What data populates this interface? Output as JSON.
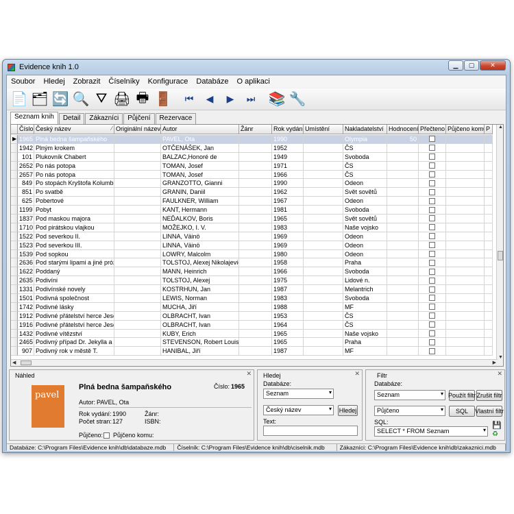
{
  "window": {
    "title": "Evidence knih 1.0"
  },
  "menu": [
    "Soubor",
    "Hledej",
    "Zobrazit",
    "Číselníky",
    "Konfigurace",
    "Databáze",
    "O aplikaci"
  ],
  "toolbar": [
    {
      "name": "new-document-icon",
      "glyph": "📄"
    },
    {
      "name": "form-view-icon",
      "glyph": "🗂"
    },
    {
      "name": "refresh-icon",
      "glyph": "🔄"
    },
    {
      "name": "search-icon",
      "glyph": "🔍"
    },
    {
      "name": "filter-icon",
      "glyph": "⛛"
    },
    {
      "name": "print-icon",
      "glyph": "🖨"
    },
    {
      "name": "print-preview-icon",
      "glyph": "🖶"
    },
    {
      "name": "exit-icon",
      "glyph": "🚪"
    },
    {
      "name": "first-record-icon",
      "glyph": "⏮"
    },
    {
      "name": "previous-record-icon",
      "glyph": "◀"
    },
    {
      "name": "next-record-icon",
      "glyph": "▶"
    },
    {
      "name": "last-record-icon",
      "glyph": "⏭"
    },
    {
      "name": "books-icon",
      "glyph": "📚"
    },
    {
      "name": "tools-icon",
      "glyph": "🔧"
    }
  ],
  "tabs": [
    "Seznam knih",
    "Detail",
    "Zákazníci",
    "Půjčení",
    "Rezervace"
  ],
  "grid": {
    "columns": [
      "",
      "Číslo",
      "Český název",
      "Originální název",
      "Autor",
      "Žánr",
      "Rok vydání",
      "Umístění",
      "Nakladatelství",
      "Hodnocení",
      "Přečteno",
      "Půjčeno komu",
      "P"
    ],
    "rows": [
      [
        "1965",
        "Plná bedna šampaňského",
        "",
        "PAVEL, Ota",
        "",
        "1990",
        "",
        "Olympia",
        "50"
      ],
      [
        "1942",
        "Plným krokem",
        "",
        "OTČENÁŠEK, Jan",
        "",
        "1952",
        "",
        "ČS",
        ""
      ],
      [
        "101",
        "Plukovník Chabert",
        "",
        "BALZAC,Honoré de",
        "",
        "1949",
        "",
        "Svoboda",
        ""
      ],
      [
        "2652",
        "Po nás potopa",
        "",
        "TOMAN, Josef",
        "",
        "1971",
        "",
        "ČS",
        ""
      ],
      [
        "2657",
        "Po nás potopa",
        "",
        "TOMAN, Josef",
        "",
        "1966",
        "",
        "ČS",
        ""
      ],
      [
        "849",
        "Po stopách Kryštofa Kolumba",
        "",
        "GRANZOTTO, Gianni",
        "",
        "1990",
        "",
        "Odeon",
        ""
      ],
      [
        "851",
        "Po svatbě",
        "",
        "GRANIN, Daniil",
        "",
        "1962",
        "",
        "Svět sovětů",
        ""
      ],
      [
        "625",
        "Pobertové",
        "",
        "FAULKNER, William",
        "",
        "1967",
        "",
        "Odeon",
        ""
      ],
      [
        "1199",
        "Pobyt",
        "",
        "KANT, Hermann",
        "",
        "1981",
        "",
        "Svoboda",
        ""
      ],
      [
        "1837",
        "Pod maskou majora",
        "",
        "NEĎALKOV, Boris",
        "",
        "1965",
        "",
        "Svět sovětů",
        ""
      ],
      [
        "1710",
        "Pod pirátskou vlajkou",
        "",
        "MOŽEJKO, I. V.",
        "",
        "1983",
        "",
        "Naše vojsko",
        ""
      ],
      [
        "1522",
        "Pod severkou II.",
        "",
        "LINNA, Väinö",
        "",
        "1969",
        "",
        "Odeon",
        ""
      ],
      [
        "1523",
        "Pod severkou III.",
        "",
        "LINNA, Väinö",
        "",
        "1969",
        "",
        "Odeon",
        ""
      ],
      [
        "1539",
        "Pod sopkou",
        "",
        "LOWRY, Malcolm",
        "",
        "1980",
        "",
        "Odeon",
        ""
      ],
      [
        "2636",
        "Pod starými lipami a jiné prózy",
        "",
        "TOLSTOJ, Alexej Nikolajevič",
        "",
        "1958",
        "",
        "Praha",
        ""
      ],
      [
        "1622",
        "Poddaný",
        "",
        "MANN, Heinrich",
        "",
        "1966",
        "",
        "Svoboda",
        ""
      ],
      [
        "2635",
        "Podivíni",
        "",
        "TOLSTOJ, Alexej",
        "",
        "1975",
        "",
        "Lidové n.",
        ""
      ],
      [
        "1331",
        "Podivínské novely",
        "",
        "KOSTRHUN, Jan",
        "",
        "1987",
        "",
        "Melantrich",
        ""
      ],
      [
        "1501",
        "Podivná společnost",
        "",
        "LEWIS, Norman",
        "",
        "1983",
        "",
        "Svoboda",
        ""
      ],
      [
        "1742",
        "Podivné lásky",
        "",
        "MUCHA, Jiří",
        "",
        "1988",
        "",
        "MF",
        ""
      ],
      [
        "1912",
        "Podivné přátelství herce Jesenia",
        "",
        "OLBRACHT, Ivan",
        "",
        "1953",
        "",
        "ČS",
        ""
      ],
      [
        "1916",
        "Podivné přátelství herce Jesenia",
        "",
        "OLBRACHT, Ivan",
        "",
        "1964",
        "",
        "ČS",
        ""
      ],
      [
        "1432",
        "Podivné vítězství",
        "",
        "KUBY, Erich",
        "",
        "1965",
        "",
        "Naše vojsko",
        ""
      ],
      [
        "2465",
        "Podivný případ Dr. Jekylla a pana",
        "",
        "STEVENSON, Robert Louis",
        "",
        "1965",
        "",
        "Praha",
        ""
      ],
      [
        "907",
        "Podivný rok v městě T.",
        "",
        "HANIBAL, Jiří",
        "",
        "1987",
        "",
        "MF",
        ""
      ]
    ]
  },
  "preview": {
    "title": "Náhled",
    "book_title": "Plná bedna šampaňského",
    "number_label": "Číslo:",
    "number": "1965",
    "author_label": "Autor:",
    "author": "PAVEL, Ota",
    "year_label": "Rok vydání:",
    "year": "1990",
    "genre_label": "Žánr:",
    "pages_label": "Počet stran:",
    "pages": "127",
    "isbn_label": "ISBN:",
    "lent_label": "Půjčeno:",
    "lent_to_label": "Půjčeno komu:",
    "cover_text": "pavel"
  },
  "search": {
    "title": "Hledej",
    "db_label": "Databáze:",
    "db_value": "Seznam",
    "field_value": "Český název",
    "button": "Hledej",
    "text_label": "Text:"
  },
  "filter": {
    "title": "Filtr",
    "db_label": "Databáze:",
    "db_value": "Seznam",
    "apply": "Použít filtr",
    "cancel": "Zrušit filtr",
    "field_value": "Půjčeno",
    "sql_button": "SQL",
    "custom": "Vlastní filtr",
    "sql_label": "SQL:",
    "sql_value": "SELECT * FROM Seznam"
  },
  "status": [
    "Databáze: C:\\Program Files\\Evidence knih\\db\\databaze.mdb",
    "Číselník: C:\\Program Files\\Evidence knih\\db\\ciselnik.mdb",
    "Zákazníci: C:\\Program Files\\Evidence knih\\db\\zakaznici.mdb"
  ]
}
